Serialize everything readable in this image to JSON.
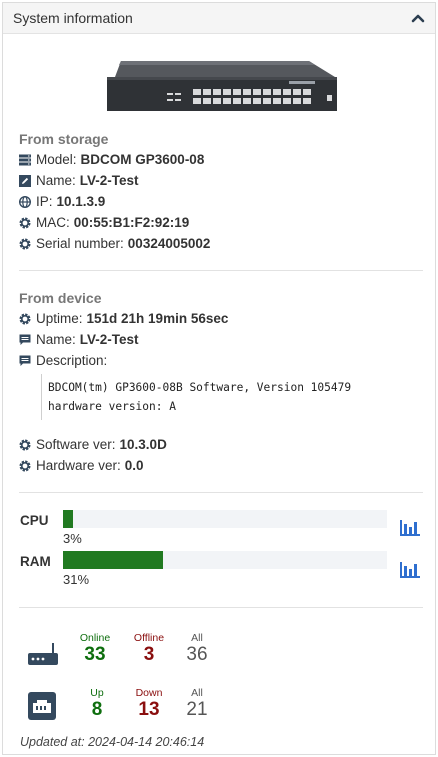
{
  "panel": {
    "title": "System information"
  },
  "storage": {
    "title": "From storage",
    "model": {
      "label": "Model:",
      "value": "BDCOM GP3600-08"
    },
    "name": {
      "label": "Name:",
      "value": "LV-2-Test"
    },
    "ip": {
      "label": "IP:",
      "value": "10.1.3.9"
    },
    "mac": {
      "label": "MAC:",
      "value": "00:55:B1:F2:92:19"
    },
    "serial": {
      "label": "Serial number:",
      "value": "00324005002"
    }
  },
  "device": {
    "title": "From device",
    "uptime": {
      "label": "Uptime:",
      "value": "151d 21h 19min 56sec"
    },
    "name": {
      "label": "Name:",
      "value": "LV-2-Test"
    },
    "description": {
      "label": "Description:",
      "value": "BDCOM(tm) GP3600-08B Software, Version 105479\nhardware version: A"
    },
    "software": {
      "label": "Software ver:",
      "value": "10.3.0D"
    },
    "hardware": {
      "label": "Hardware ver:",
      "value": "0.0"
    }
  },
  "meters": {
    "cpu": {
      "label": "CPU",
      "percent": 3,
      "text": "3%"
    },
    "ram": {
      "label": "RAM",
      "percent": 31,
      "text": "31%"
    },
    "fill_color": "#217a21"
  },
  "stats": {
    "onu": {
      "online_label": "Online",
      "online": "33",
      "offline_label": "Offline",
      "offline": "3",
      "all_label": "All",
      "all": "36"
    },
    "ports": {
      "up_label": "Up",
      "up": "8",
      "down_label": "Down",
      "down": "13",
      "all_label": "All",
      "all": "21"
    }
  },
  "updated": "Updated at: 2024-04-14 20:46:14",
  "icons": {
    "collapse": "chevron-up-icon",
    "model": "server-icon",
    "name": "edit-icon",
    "ip": "globe-icon",
    "mac": "gear-icon",
    "serial": "gear-icon",
    "description": "comment-icon",
    "chart": "bar-chart-icon",
    "onu": "router-icon",
    "ports": "ethernet-port-icon"
  },
  "colors": {
    "accent": "#2f6fcf",
    "online": "#0e6e0e",
    "offline": "#8a0e0e",
    "icon": "#34495e"
  }
}
